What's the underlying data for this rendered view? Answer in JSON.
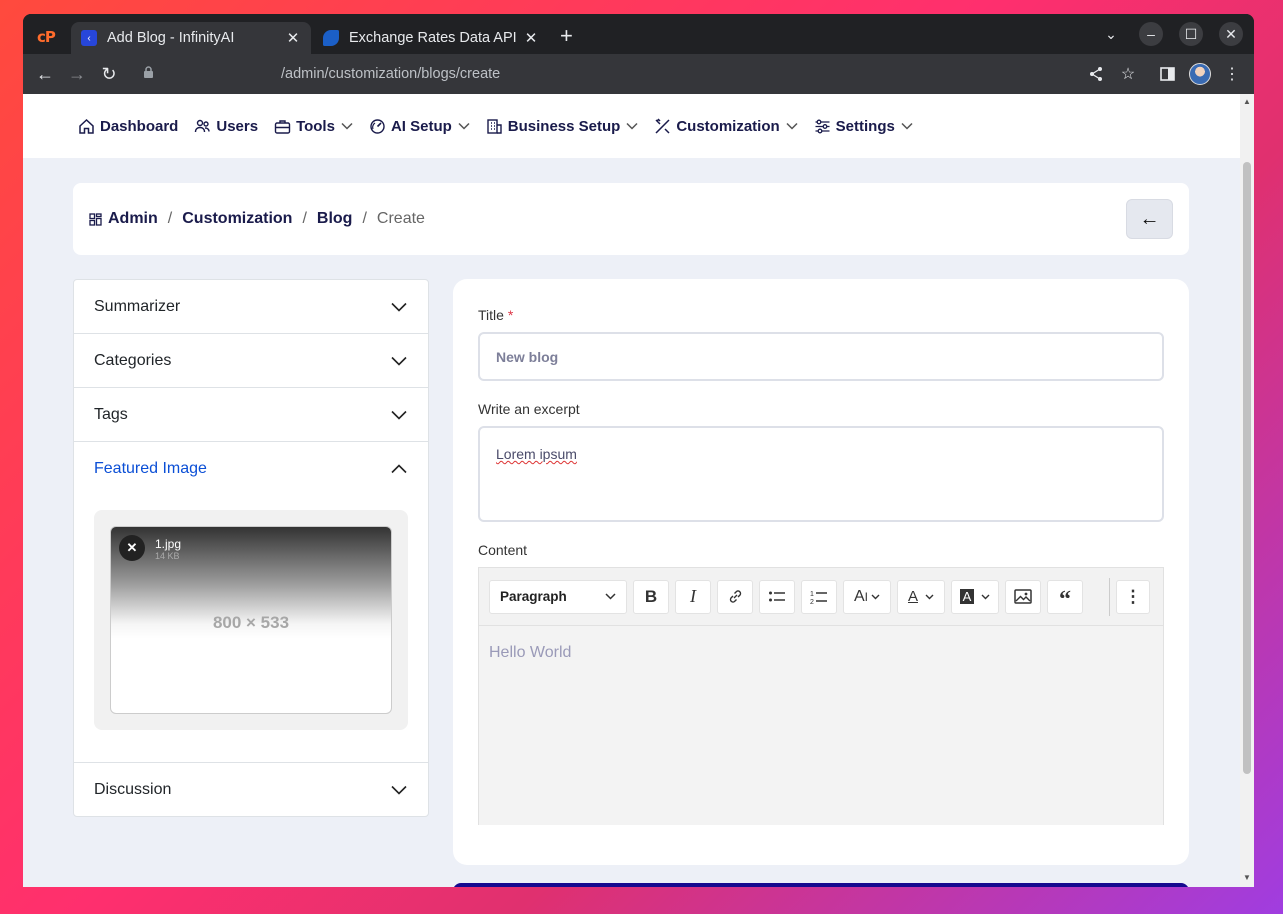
{
  "browser": {
    "tabs": [
      {
        "title": "Add Blog - InfinityAI",
        "active": true
      },
      {
        "title": "Exchange Rates Data API",
        "active": false
      }
    ],
    "url": "/admin/customization/blogs/create"
  },
  "nav": {
    "items": [
      {
        "label": "Dashboard",
        "icon": "home-icon",
        "dropdown": false
      },
      {
        "label": "Users",
        "icon": "users-icon",
        "dropdown": false
      },
      {
        "label": "Tools",
        "icon": "briefcase-icon",
        "dropdown": true
      },
      {
        "label": "AI Setup",
        "icon": "gauge-icon",
        "dropdown": true
      },
      {
        "label": "Business Setup",
        "icon": "building-icon",
        "dropdown": true
      },
      {
        "label": "Customization",
        "icon": "tools-icon",
        "dropdown": true
      },
      {
        "label": "Settings",
        "icon": "sliders-icon",
        "dropdown": true
      }
    ]
  },
  "breadcrumb": {
    "items": [
      "Admin",
      "Customization",
      "Blog"
    ],
    "current": "Create",
    "back_label": "←"
  },
  "sidebar": {
    "sections": [
      {
        "label": "Summarizer",
        "open": false
      },
      {
        "label": "Categories",
        "open": false
      },
      {
        "label": "Tags",
        "open": false
      },
      {
        "label": "Featured Image",
        "open": true
      },
      {
        "label": "Discussion",
        "open": false
      }
    ],
    "featured_image": {
      "file_name": "1.jpg",
      "file_size": "14 KB",
      "placeholder_text": "800 × 533"
    }
  },
  "form": {
    "title_label": "Title",
    "required_mark": "*",
    "title_value": "New blog",
    "excerpt_label": "Write an excerpt",
    "excerpt_value": "Lorem ipsum",
    "content_label": "Content",
    "content_value": "Hello World",
    "toolbar": {
      "paragraph_select": "Paragraph"
    }
  },
  "colors": {
    "accent": "#0b4fd6",
    "nav_text": "#1a1b4b",
    "page_bg": "#edf0f7",
    "bottom_bar": "#160a8f"
  }
}
